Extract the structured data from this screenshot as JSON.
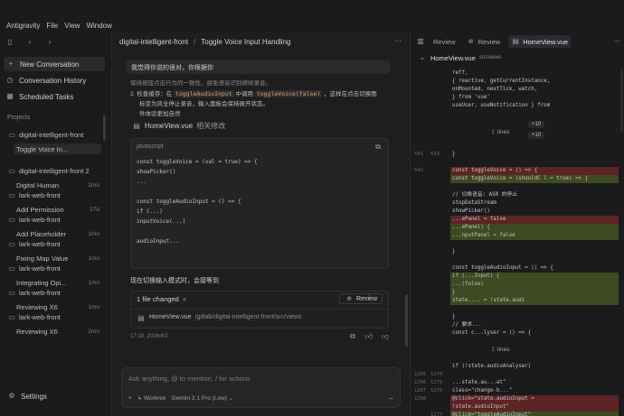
{
  "menubar": {
    "app": "Antigravity",
    "items": [
      "File",
      "View",
      "Window"
    ]
  },
  "sidebar": {
    "new_conversation": "New Conversation",
    "conversation_history": "Conversation History",
    "scheduled_tasks": "Scheduled Tasks",
    "projects_label": "Projects",
    "projects": [
      {
        "name": "digital-intelligent-front",
        "conversations": [
          {
            "title": "Toggle Voice In...",
            "age": ""
          }
        ]
      },
      {
        "name": "digital-intelligent-front 2",
        "conversations": [
          {
            "title": "Digital Human",
            "age": "2mo"
          }
        ]
      },
      {
        "name": "lark-web-front",
        "conversations": [
          {
            "title": "Add Permission",
            "age": "27d"
          }
        ]
      },
      {
        "name": "lark-web-front",
        "conversations": [
          {
            "title": "Add Placeholder",
            "age": "1mo"
          }
        ]
      },
      {
        "name": "lark-web-front",
        "conversations": [
          {
            "title": "Fixing Map Value",
            "age": "1mo"
          }
        ]
      },
      {
        "name": "lark-web-front",
        "conversations": [
          {
            "title": "Integrating Opi...",
            "age": "1mo"
          }
        ]
      },
      {
        "name": "lark-web-front",
        "conversations": [
          {
            "title": "Reviewing X6",
            "age": "1mo"
          }
        ]
      },
      {
        "name": "lark-web-front",
        "conversations": [
          {
            "title": "Reviewing X6",
            "age": "2mo"
          }
        ]
      }
    ],
    "settings": "Settings"
  },
  "center": {
    "breadcrumb": [
      "digital-intelligent-front",
      "Toggle Voice Input Handling"
    ],
    "user_message": "我觉得你说的很对，你根据你",
    "point_1": "保持按钮点击行为的一致性，避免语音识别继续录音。",
    "point_2_prefix": "2.  检查缓存：在",
    "point_2_code1": "toggleAudioInput",
    "point_2_mid": "中调用",
    "point_2_code2": "toggleVoice(false)",
    "point_2_suffix": "，这样在点击切换图",
    "point_2_line2": "标变为风全停止录音，输入面板会保持展开状态。",
    "point_2_line3": "件体验更加自然",
    "file_ref": "HomeView.vue",
    "file_ref_note": "相关修改",
    "code_lang": "javascript",
    "code_lines": [
      "const toggleVoice = (val = true) => {",
      "  showPicker()",
      "  ...",
      "const toggleAudioInput = () => {",
      "  if (...)",
      "  inputVoice(...)",
      "  audioInput..."
    ],
    "summary": "现在切换输入模式时，会接等到",
    "changes": {
      "count_label": "1 file changed",
      "plus": "+",
      "review": "Review",
      "file": "HomeView.vue",
      "path": "/gitlab/digital-intelligent-front/src/views"
    },
    "timestamp": "17:18, 2026/4/2",
    "composer": {
      "placeholder": "Ask anything, @ to mention, / for actions",
      "add": "+",
      "mode": "Workree",
      "model": "Gemini 3.1 Pro (Low)"
    }
  },
  "right": {
    "tabs": [
      "Review",
      "Review",
      "HomeView.vue"
    ],
    "file": "HomeView.vue",
    "file_path": "src/views",
    "pills": [
      "+10",
      "+10"
    ],
    "expand_label": "lines",
    "lines": [
      {
        "old": "",
        "new": "",
        "type": "ctx",
        "code": "  reff,"
      },
      {
        "old": "",
        "new": "",
        "type": "ctx",
        "code": "  { reactive, getCurrentInstance,"
      },
      {
        "old": "",
        "new": "",
        "type": "ctx",
        "code": "  onMounted, nextTick, watch,"
      },
      {
        "old": "",
        "new": "",
        "type": "ctx",
        "code": "  } from 'vue'"
      },
      {
        "old": "",
        "new": "",
        "type": "ctx",
        "code": "  useUser, useNotification } from"
      },
      {
        "old": "541",
        "new": "539",
        "type": "ctx",
        "code": "}"
      },
      {
        "old": "542",
        "new": "",
        "type": "del",
        "code": "const toggleVoice = () => {"
      },
      {
        "old": "",
        "new": "",
        "type": "add",
        "code": "const toggleVoice = (shouldC    l = true) => {"
      },
      {
        "old": "",
        "new": "",
        "type": "ctx",
        "code": "  // 切换语音: ASR 的停止"
      },
      {
        "old": "",
        "new": "",
        "type": "ctx",
        "code": "  stopDataStream"
      },
      {
        "old": "",
        "new": "",
        "type": "ctx",
        "code": "  showPicker()"
      },
      {
        "old": "",
        "new": "",
        "type": "del",
        "code": "  ...ePanel = false"
      },
      {
        "old": "",
        "new": "",
        "type": "add",
        "code": "  ...ePanel) {"
      },
      {
        "old": "",
        "new": "",
        "type": "add",
        "code": "  ...nputPanel = false"
      },
      {
        "old": "",
        "new": "",
        "type": "ctx",
        "code": "}"
      },
      {
        "old": "",
        "new": "",
        "type": "ctx",
        "code": "const toggleAudioInput = () => {"
      },
      {
        "old": "",
        "new": "",
        "type": "add",
        "code": "  if (...Input) {"
      },
      {
        "old": "",
        "new": "",
        "type": "add",
        "code": "    ...(false)"
      },
      {
        "old": "",
        "new": "",
        "type": "add",
        "code": "  }"
      },
      {
        "old": "",
        "new": "",
        "type": "add",
        "code": "  state.... = !state.audi"
      },
      {
        "old": "",
        "new": "",
        "type": "ctx",
        "code": "}"
      },
      {
        "old": "",
        "new": "",
        "type": "ctx",
        "code": "// 要求..."
      },
      {
        "old": "",
        "new": "",
        "type": "ctx",
        "code": "const c...lyser = () => {"
      },
      {
        "old": "",
        "new": "",
        "type": "ctx",
        "code": "  if (!state.audioAnalyser)"
      },
      {
        "old": "1265",
        "new": "1274",
        "type": "ctx",
        "code": ""
      },
      {
        "old": "1266",
        "new": "1275",
        "type": "ctx",
        "code": "    ...state.au...at\""
      },
      {
        "old": "1267",
        "new": "1276",
        "type": "ctx",
        "code": "    class=\"change-b...\""
      },
      {
        "old": "1268",
        "new": "",
        "type": "del",
        "code": "    @click=\"state.audioInput ="
      },
      {
        "old": "",
        "new": "",
        "type": "del",
        "code": "!state.audioInput\""
      },
      {
        "old": "",
        "new": "1277",
        "type": "add",
        "code": "    @click=\"toggleAudioInput\""
      }
    ]
  }
}
